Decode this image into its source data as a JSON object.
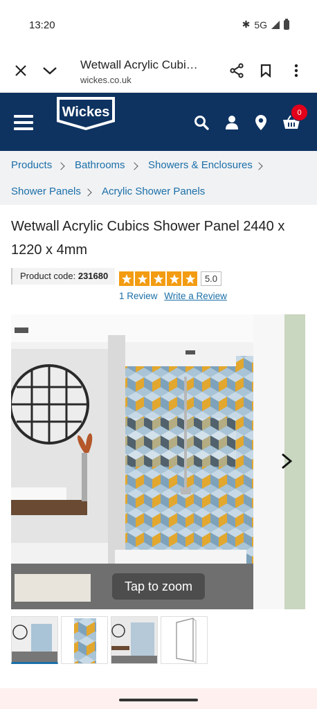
{
  "status": {
    "time": "13:20",
    "network": "5G",
    "icons": [
      "bluetooth-icon",
      "signal-icon",
      "battery-icon"
    ]
  },
  "browser": {
    "title": "Wetwall Acrylic Cubi…",
    "url": "wickes.co.uk",
    "icons": [
      "close-icon",
      "chevron-down-icon",
      "share-icon",
      "bookmark-icon",
      "more-icon"
    ]
  },
  "header": {
    "logo": "Wickes",
    "cart_count": "0",
    "brand_color": "#0e3361",
    "icons": [
      "menu-icon",
      "search-icon",
      "account-icon",
      "location-icon",
      "basket-icon"
    ]
  },
  "breadcrumb": [
    "Products",
    "Bathrooms",
    "Showers & Enclosures",
    "Shower Panels",
    "Acrylic Shower Panels"
  ],
  "product": {
    "title": "Wetwall Acrylic Cubics Shower Panel 2440 x 1220 x 4mm",
    "code_label": "Product code:",
    "code": "231680",
    "rating": "5.0",
    "stars": 5,
    "reviews_count": "1 Review",
    "write_review": "Write a Review"
  },
  "gallery": {
    "zoom_hint": "Tap to zoom",
    "thumb_count": 4,
    "active_thumb": 1
  }
}
